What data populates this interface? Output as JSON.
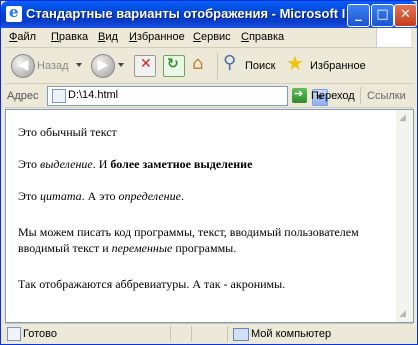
{
  "window": {
    "title": "Стандартные варианты отображения - Microsoft Internet Explorer"
  },
  "menu": [
    "Файл",
    "Правка",
    "Вид",
    "Избранное",
    "Сервис",
    "Справка"
  ],
  "toolbar": {
    "back_label": "Назад",
    "search_label": "Поиск",
    "favorites_label": "Избранное"
  },
  "address": {
    "label": "Адрес",
    "value": "D:\\14.html",
    "go_label": "Переход",
    "links_label": "Ссылки"
  },
  "content": {
    "line1": "Это обычный текст",
    "line2_a": "Это ",
    "line2_em": "выделение",
    "line2_b": ". И ",
    "line2_strong": "более заметное выделение",
    "line3_a": "Это ",
    "line3_cite": "цитата",
    "line3_b": ". А это ",
    "line3_dfn": "определение",
    "line3_c": ".",
    "line4_a": "Мы можем писать код программы, текст, вводимый пользователем ",
    "line4_kbd": "вводимый текст",
    "line4_b": " и ",
    "line4_var": "переменные",
    "line4_c": " программы.",
    "line5": "Так отображаются аббревиатуры. А так - акронимы."
  },
  "status": {
    "text": "Готово",
    "zone": "Мой компьютер"
  },
  "colors": {
    "titlebar": "#0046d5",
    "chrome": "#ece9d8",
    "content_bg": "#ffffff"
  }
}
